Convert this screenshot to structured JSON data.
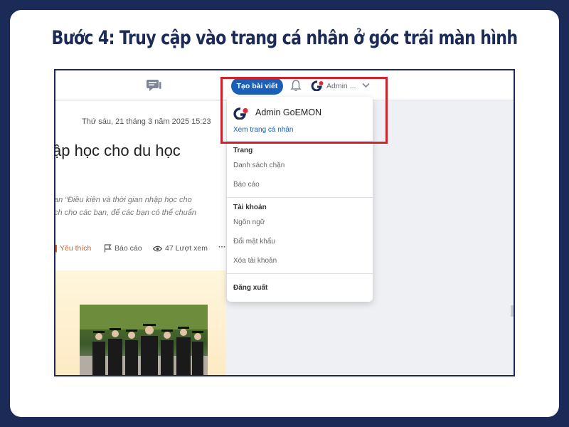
{
  "heading": "Bước 4: Truy cập vào trang cá nhân ở góc trái màn hình",
  "topbar": {
    "create_post_label": "Tạo bài viết",
    "admin_short": "Admin ...",
    "icons": [
      "chat-icon",
      "bell-icon",
      "goemon-logo",
      "chevron-down-icon"
    ]
  },
  "article": {
    "date": "Thứ sáu, 21 tháng 3 năm 2025 15:23",
    "title": "ập học cho du học",
    "excerpt_line1": "an “Điều kiện và thời gian nhập học cho",
    "excerpt_line2": "ch cho các bạn, để các bạn có thể chuẩn",
    "like_label": "Yêu thích",
    "report_label": "Báo cáo",
    "views_label": "47 Lượt xem",
    "more_label": "···"
  },
  "menu": {
    "user_name": "Admin GoEMON",
    "profile_link": "Xem trang cá nhân",
    "section_page": "Trang",
    "blocked_list": "Danh sách chặn",
    "reports": "Báo cáo",
    "section_account": "Tài khoản",
    "language": "Ngôn ngữ",
    "change_password": "Đổi mật khẩu",
    "delete_account": "Xóa tài khoản",
    "logout": "Đăng xuất"
  },
  "colors": {
    "background": "#1c2a57",
    "accent_blue": "#1b5fb6",
    "highlight_red": "#d1232b",
    "like_orange": "#e0601e"
  }
}
